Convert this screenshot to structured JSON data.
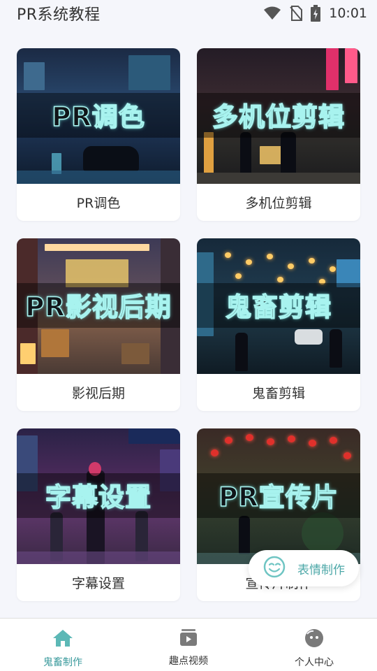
{
  "status_bar": {
    "app_title": "PR系统教程",
    "time": "10:01",
    "icons": [
      "wifi-icon",
      "no-sim-icon",
      "battery-charging-icon"
    ]
  },
  "cards": [
    {
      "overlay": "PR调色",
      "caption": "PR调色",
      "scene": "rainy-street"
    },
    {
      "overlay": "多机位剪辑",
      "caption": "多机位剪辑",
      "scene": "neon-alley"
    },
    {
      "overlay": "PR影视后期",
      "caption": "影视后期",
      "scene": "shop-street"
    },
    {
      "overlay": "鬼畜剪辑",
      "caption": "鬼畜剪辑",
      "scene": "lantern-street"
    },
    {
      "overlay": "字幕设置",
      "caption": "字幕设置",
      "scene": "cyberpunk-hotel"
    },
    {
      "overlay": "PR宣传片",
      "caption": "宣传片制作",
      "scene": "red-lantern-street"
    }
  ],
  "float_button": {
    "label": "表情制作",
    "icon": "smile-face-icon"
  },
  "bottom_nav": [
    {
      "label": "鬼畜制作",
      "icon": "home-icon",
      "active": true
    },
    {
      "label": "趣点视频",
      "icon": "video-icon",
      "active": false
    },
    {
      "label": "个人中心",
      "icon": "face-icon",
      "active": false
    }
  ],
  "colors": {
    "accent": "#3a9a9c",
    "background": "#f5f6fb",
    "overlay_text_glow": "#a8f3ef"
  }
}
